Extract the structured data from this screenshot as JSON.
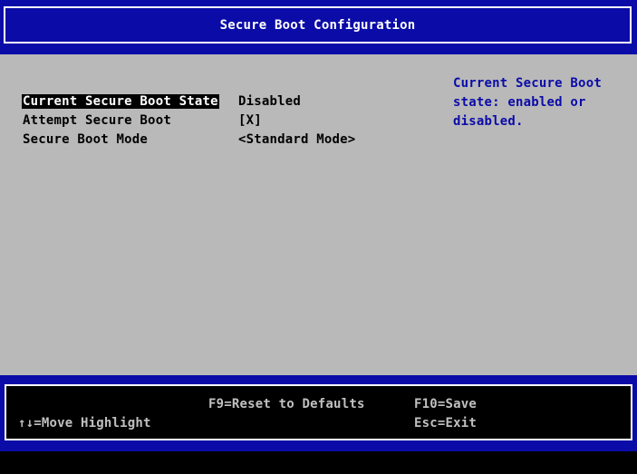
{
  "header": {
    "title": "Secure Boot Configuration"
  },
  "settings": [
    {
      "label": "Current Secure Boot State",
      "value": "Disabled",
      "selected": true
    },
    {
      "label": "Attempt Secure Boot",
      "value": "[X]",
      "selected": false
    },
    {
      "label": "Secure Boot Mode",
      "value": "<Standard Mode>",
      "selected": false
    }
  ],
  "help": {
    "text": "Current Secure Boot\nstate: enabled or\ndisabled."
  },
  "footer": {
    "move_highlight": "↑↓=Move Highlight",
    "reset_defaults": "F9=Reset to Defaults",
    "save": "F10=Save",
    "exit": "Esc=Exit"
  },
  "colors": {
    "header_bg": "#0b0ba8",
    "panel_bg": "#b9b9b9",
    "help_text": "#0b0ba8",
    "footer_bg": "#0b0ba8",
    "selected_bg": "#000000",
    "selected_fg": "#ffffff"
  }
}
